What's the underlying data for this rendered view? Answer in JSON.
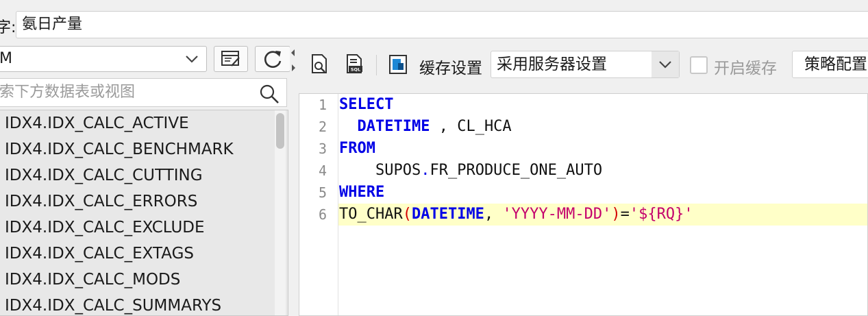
{
  "name_field": {
    "label": "字:",
    "value": "氨日产量"
  },
  "left_panel": {
    "db_select": {
      "value": "M"
    },
    "search": {
      "placeholder": "索下方数据表或视图"
    },
    "tables": [
      "IDX4.IDX_CALC_ACTIVE",
      "IDX4.IDX_CALC_BENCHMARK",
      "IDX4.IDX_CALC_CUTTING",
      "IDX4.IDX_CALC_ERRORS",
      "IDX4.IDX_CALC_EXCLUDE",
      "IDX4.IDX_CALC_EXTAGS",
      "IDX4.IDX_CALC_MODS",
      "IDX4.IDX_CALC_SUMMARYS"
    ]
  },
  "toolbar": {
    "cache_label": "缓存设置",
    "cache_select_value": "采用服务器设置",
    "enable_cache_label": "开启缓存",
    "strategy_label": "策略配置"
  },
  "editor": {
    "line_numbers": [
      "1",
      "2",
      "3",
      "4",
      "5",
      "6"
    ],
    "line1": {
      "kw": "SELECT"
    },
    "line2": {
      "indent": "  ",
      "kw": "DATETIME",
      "rest": " , CL_HCA"
    },
    "line3": {
      "kw": "FROM"
    },
    "line4": {
      "indent": "    ",
      "schema": "SUPOS",
      "dot": ".",
      "table": "FR_PRODUCE_ONE_AUTO"
    },
    "line5": {
      "kw": "WHERE"
    },
    "line6": {
      "fn": "TO_CHAR",
      "open": "(",
      "kw": "DATETIME",
      "comma": ", ",
      "fmt": "'YYYY-MM-DD'",
      "close": ")",
      "eq": "=",
      "param": "'${RQ}'"
    }
  },
  "colors": {
    "keyword": "#0000e6",
    "string": "#c4006c",
    "paren": "#d40000",
    "highlight": "#ffffc8"
  }
}
